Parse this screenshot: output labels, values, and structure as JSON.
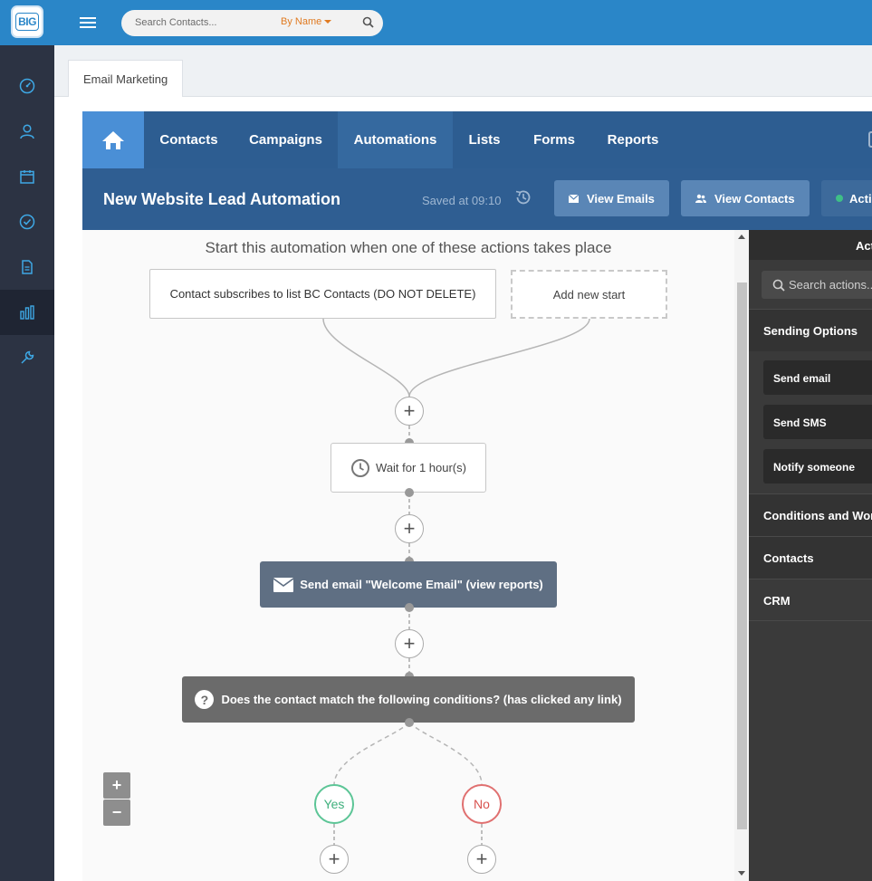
{
  "app": {
    "logo_text": "BIG",
    "search_placeholder": "Search Contacts...",
    "search_scope": "By Name"
  },
  "sidebar": {
    "items": [
      {
        "name": "dashboard-icon",
        "active": false
      },
      {
        "name": "user-icon",
        "active": false
      },
      {
        "name": "calendar-icon",
        "active": false
      },
      {
        "name": "check-circle-icon",
        "active": false
      },
      {
        "name": "document-icon",
        "active": false
      },
      {
        "name": "bar-chart-icon",
        "active": true
      },
      {
        "name": "wrench-icon",
        "active": false
      }
    ]
  },
  "page_tab": "Email Marketing",
  "nav": {
    "items": [
      {
        "label": "Contacts",
        "active": false
      },
      {
        "label": "Campaigns",
        "active": false
      },
      {
        "label": "Automations",
        "active": true
      },
      {
        "label": "Lists",
        "active": false
      },
      {
        "label": "Forms",
        "active": false
      },
      {
        "label": "Reports",
        "active": false
      }
    ]
  },
  "automation": {
    "title": "New Website Lead Automation",
    "saved": "Saved at 09:10",
    "buttons": {
      "view_emails": "View Emails",
      "view_contacts": "View Contacts",
      "active_partial": "Acti"
    }
  },
  "canvas": {
    "heading": "Start this automation when one of these actions takes place",
    "start_trigger": "Contact subscribes to list BC Contacts (DO NOT DELETE)",
    "add_new_start": "Add new start",
    "wait_step": "Wait for 1 hour(s)",
    "email_step": "Send email \"Welcome Email\" (view reports)",
    "condition_step": "Does the contact match the following conditions? (has clicked any link)",
    "yes_label": "Yes",
    "no_label": "No",
    "zoom_in": "+",
    "zoom_out": "−",
    "plus_symbol": "+"
  },
  "actions_panel": {
    "header_partial": "Act",
    "search_placeholder": "Search actions...",
    "sections": {
      "sending_options": "Sending Options",
      "conditions_workflow": "Conditions and Wor",
      "contacts": "Contacts",
      "crm": "CRM"
    },
    "sending_items": [
      "Send email",
      "Send SMS",
      "Notify someone"
    ]
  },
  "colors": {
    "topbar": "#2a86c8",
    "sidebar": "#2c3343",
    "nav": "#2d5d91",
    "nav_home": "#4a8fd6",
    "yes": "#3fb07d",
    "no": "#d9534f",
    "search_scope": "#e07b22"
  }
}
